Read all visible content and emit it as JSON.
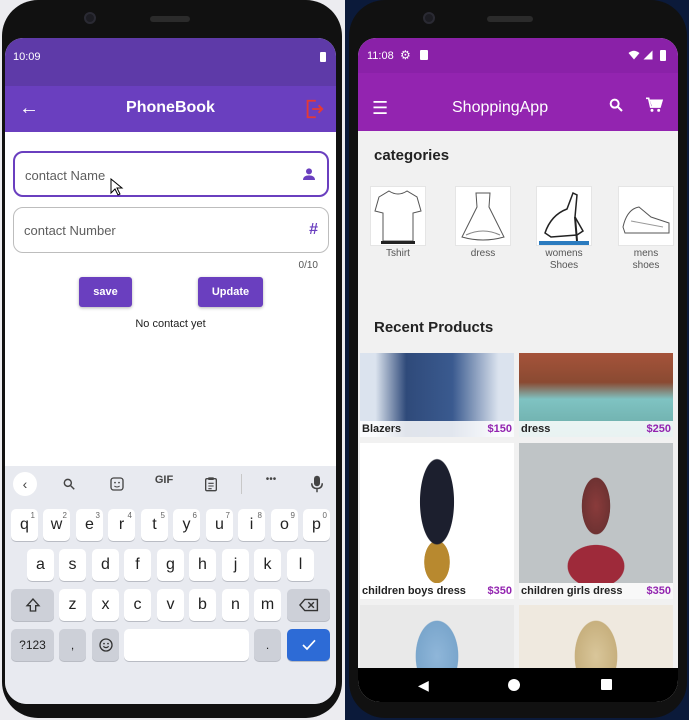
{
  "left_phone": {
    "status_time": "10:09",
    "app_title": "PhoneBook",
    "contact_name_placeholder": "contact Name",
    "contact_number_placeholder": "contact Number",
    "number_icon": "#",
    "counter": "0/10",
    "save_label": "save",
    "update_label": "Update",
    "empty_message": "No contact yet",
    "keyboard": {
      "toolbar": {
        "gif": "GIF",
        "more": "•••"
      },
      "row1": [
        "q",
        "w",
        "e",
        "r",
        "t",
        "y",
        "u",
        "i",
        "o",
        "p"
      ],
      "row1_hints": [
        "1",
        "2",
        "3",
        "4",
        "5",
        "6",
        "7",
        "8",
        "9",
        "0"
      ],
      "row2": [
        "a",
        "s",
        "d",
        "f",
        "g",
        "h",
        "j",
        "k",
        "l"
      ],
      "row3": [
        "z",
        "x",
        "c",
        "v",
        "b",
        "n",
        "m"
      ],
      "symbols_label": "?123",
      "comma": ",",
      "period": "."
    },
    "colors": {
      "primary": "#6a3fbf",
      "status": "#5e3aa8",
      "logout": "#e53935"
    }
  },
  "right_phone": {
    "status_time": "11:08",
    "app_title": "ShoppingApp",
    "categories_title": "categories",
    "categories": [
      {
        "label": "Tshirt"
      },
      {
        "label": "dress"
      },
      {
        "label": "womens\nShoes"
      },
      {
        "label": "mens\nshoes"
      }
    ],
    "recent_title": "Recent Products",
    "products": [
      {
        "name": "Blazers",
        "price": "$150"
      },
      {
        "name": "dress",
        "price": "$250"
      },
      {
        "name": "children boys dress",
        "price": "$350"
      },
      {
        "name": "children girls dress",
        "price": "$350"
      },
      {
        "name": "",
        "price": ""
      },
      {
        "name": "",
        "price": ""
      }
    ],
    "colors": {
      "primary": "#9324b0",
      "price": "#9324b0"
    }
  },
  "icons": {
    "back": "back-arrow-icon",
    "logout": "logout-icon",
    "person": "person-icon",
    "menu": "menu-icon",
    "search": "search-icon",
    "cart": "cart-icon"
  }
}
